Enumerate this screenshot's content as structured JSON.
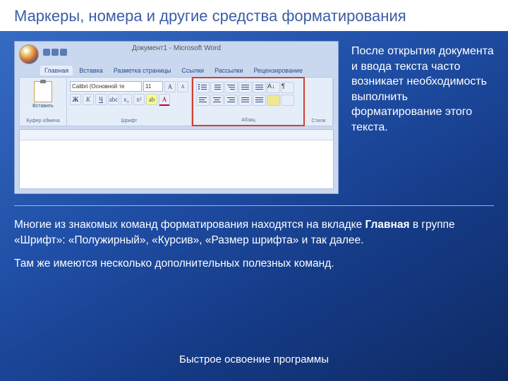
{
  "title": "Маркеры, номера и другие средства форматирования",
  "word": {
    "doc_title_1": "Документ1",
    "doc_title_2": "Microsoft Word",
    "tabs": [
      "Главная",
      "Вставка",
      "Разметка страницы",
      "Ссылки",
      "Рассылки",
      "Рецензирование"
    ],
    "clipboard": {
      "paste": "Вставить",
      "label": "Буфер обмена"
    },
    "font": {
      "name": "Calibri (Основной те",
      "size": "11",
      "label": "Шрифт",
      "bold": "Ж",
      "italic": "К",
      "underline": "Ч"
    },
    "paragraph": {
      "label": "Абзац"
    },
    "styles": {
      "label": "Стили"
    }
  },
  "side": "После открытия документа и ввода текста часто возникает необходимость выполнить форматирование этого текста.",
  "p1_a": "Многие из знакомых команд форматирования находятся на вкладке ",
  "p1_b": "Главная",
  "p1_c": " в группе «Шрифт»: «Полужирный», «Курсив», «Размер шрифта» и так далее.",
  "p2": "Там же имеются несколько дополнительных полезных команд.",
  "footer": "Быстрое освоение программы"
}
